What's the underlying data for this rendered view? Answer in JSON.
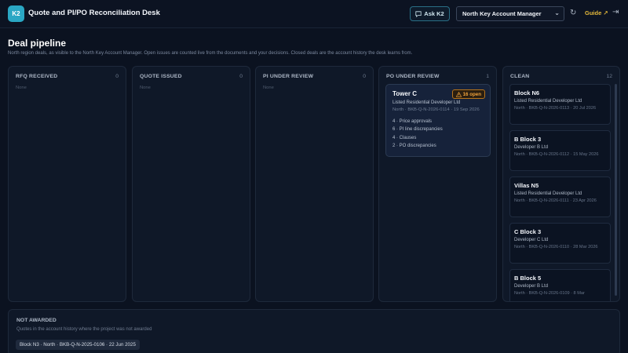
{
  "header": {
    "logo": "K2",
    "title": "Quote and PI/PO Reconciliation Desk",
    "ask_label": "Ask K2",
    "role_select": "North Key Account Manager",
    "guide_label": "Guide ↗"
  },
  "page": {
    "title": "Deal pipeline",
    "subtitle": "North region deals, as visible to the North Key Account Manager. Open issues are counted live from the documents and your decisions. Closed deals are the account history the desk learns from."
  },
  "columns": [
    {
      "title": "RFQ RECEIVED",
      "count": "0",
      "empty": "None"
    },
    {
      "title": "QUOTE ISSUED",
      "count": "0",
      "empty": "None"
    },
    {
      "title": "PI UNDER REVIEW",
      "count": "0",
      "empty": "None"
    },
    {
      "title": "PO UNDER REVIEW",
      "count": "1"
    },
    {
      "title": "CLEAN",
      "count": "12"
    }
  ],
  "po_card": {
    "name": "Tower C",
    "badge": "16 open",
    "company": "Listed Residential Developer Ltd",
    "meta": "North · BKB-Q-N-2026-0114 · 19 Sep 2026",
    "issues": [
      "4 · Price approvals",
      "6 · PI line discrepancies",
      "4 · Clauses",
      "2 · PO discrepancies"
    ]
  },
  "clean_cards": [
    {
      "name": "Block N6",
      "company": "Listed Residential Developer Ltd",
      "meta": "North · BKB-Q-N-2026-0113 · 20 Jul 2026"
    },
    {
      "name": "B Block 3",
      "company": "Developer B Ltd",
      "meta": "North · BKB-Q-N-2026-0112 · 15 May 2026"
    },
    {
      "name": "Villas N5",
      "company": "Listed Residential Developer Ltd",
      "meta": "North · BKB-Q-N-2026-0111 · 23 Apr 2026"
    },
    {
      "name": "C Block 3",
      "company": "Developer C Ltd",
      "meta": "North · BKB-Q-N-2026-0110 · 28 Mar 2026"
    },
    {
      "name": "B Block 5",
      "company": "Developer B Ltd",
      "meta": "North · BKB-Q-N-2026-0109 · 8 Mar"
    }
  ],
  "not_awarded": {
    "title": "NOT AWARDED",
    "subtitle": "Quotes in the account history where the project was not awarded",
    "chip": "Block N3 · North · BKB-Q-N-2025-0106 · 22 Jun 2025"
  }
}
